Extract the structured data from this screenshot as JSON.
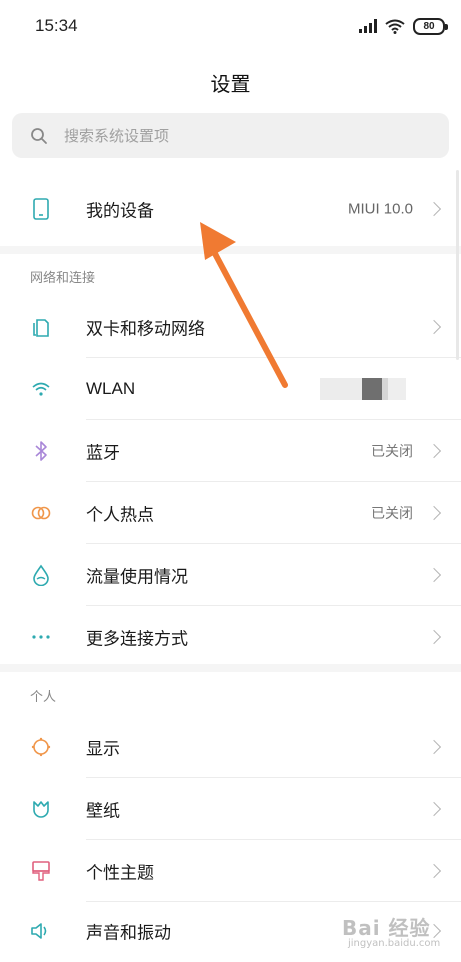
{
  "status_bar": {
    "time": "15:34",
    "battery": "80"
  },
  "title": "设置",
  "search": {
    "placeholder": "搜索系统设置项"
  },
  "my_device": {
    "label": "我的设备",
    "value": "MIUI 10.0"
  },
  "sections": {
    "network": {
      "title": "网络和连接",
      "items": [
        {
          "label": "双卡和移动网络",
          "value": ""
        },
        {
          "label": "WLAN",
          "value": ""
        },
        {
          "label": "蓝牙",
          "value": "已关闭"
        },
        {
          "label": "个人热点",
          "value": "已关闭"
        },
        {
          "label": "流量使用情况",
          "value": ""
        },
        {
          "label": "更多连接方式",
          "value": ""
        }
      ]
    },
    "personal": {
      "title": "个人",
      "items": [
        {
          "label": "显示"
        },
        {
          "label": "壁纸"
        },
        {
          "label": "个性主题"
        },
        {
          "label": "声音和振动"
        }
      ]
    }
  },
  "annotation": {
    "color": "#f07a32"
  },
  "watermark": {
    "text": "Bai 经验",
    "sub": "jingyan.baidu.com"
  },
  "colors": {
    "icon_teal": "#2eaab0",
    "icon_purple": "#a987d8",
    "icon_orange": "#f0964a",
    "icon_pink": "#e0607e"
  }
}
